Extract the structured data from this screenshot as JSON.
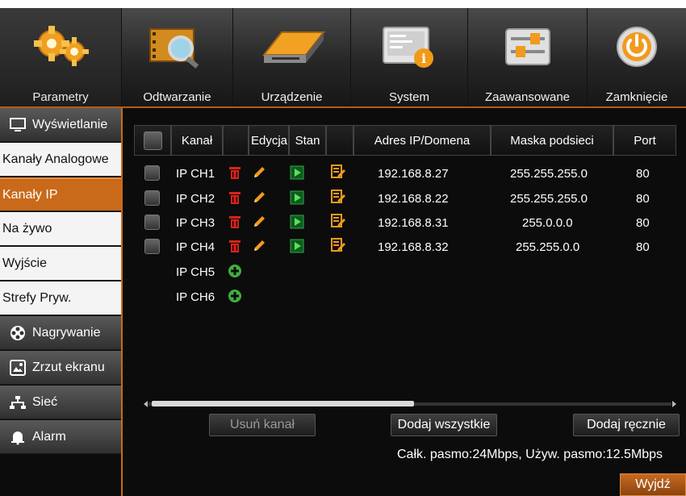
{
  "top_tabs": [
    {
      "label": "Parametry",
      "icon": "gears-icon",
      "active": true
    },
    {
      "label": "Odtwarzanie",
      "icon": "film-search-icon",
      "active": false
    },
    {
      "label": "Urządzenie",
      "icon": "hard-drive-icon",
      "active": false
    },
    {
      "label": "System",
      "icon": "system-info-icon",
      "active": false
    },
    {
      "label": "Zaawansowane",
      "icon": "sliders-icon",
      "active": false
    },
    {
      "label": "Zamknięcie",
      "icon": "power-icon",
      "active": false
    }
  ],
  "sidebar": {
    "items": [
      {
        "label": "Wyświetlanie",
        "icon": "monitor-icon"
      },
      {
        "label": "Kanały Analogowe"
      },
      {
        "label": "Kanały IP",
        "active": true
      },
      {
        "label": "Na żywo"
      },
      {
        "label": "Wyjście"
      },
      {
        "label": "Strefy Pryw."
      },
      {
        "label": "Nagrywanie",
        "icon": "film-reel-icon"
      },
      {
        "label": "Zrzut ekranu",
        "icon": "snapshot-icon"
      },
      {
        "label": "Sieć",
        "icon": "network-icon"
      },
      {
        "label": "Alarm",
        "icon": "alarm-bell-icon"
      }
    ]
  },
  "table": {
    "headers": {
      "channel": "Kanał",
      "edit": "Edycja",
      "state": "Stan",
      "ip": "Adres IP/Domena",
      "mask": "Maska podsieci",
      "port": "Port"
    },
    "rows": [
      {
        "channel": "IP CH1",
        "ip": "192.168.8.27",
        "mask": "255.255.255.0",
        "port": "80"
      },
      {
        "channel": "IP CH2",
        "ip": "192.168.8.22",
        "mask": "255.255.255.0",
        "port": "80"
      },
      {
        "channel": "IP CH3",
        "ip": "192.168.8.31",
        "mask": "255.0.0.0",
        "port": "80"
      },
      {
        "channel": "IP CH4",
        "ip": "192.168.8.32",
        "mask": "255.255.0.0",
        "port": "80"
      }
    ],
    "empty_rows": [
      {
        "channel": "IP CH5"
      },
      {
        "channel": "IP CH6"
      }
    ]
  },
  "buttons": {
    "delete_channel": "Usuń kanał",
    "add_all": "Dodaj wszystkie",
    "add_manual": "Dodaj ręcznie",
    "exit": "Wyjdź"
  },
  "bandwidth_text": "Całk. pasmo:24Mbps, Używ. pasmo:12.5Mbps",
  "colors": {
    "accent": "#c96a1b",
    "delete": "#d8231a",
    "edit": "#f29a1d",
    "ok": "#2fa84a",
    "add": "#3fae3f"
  }
}
